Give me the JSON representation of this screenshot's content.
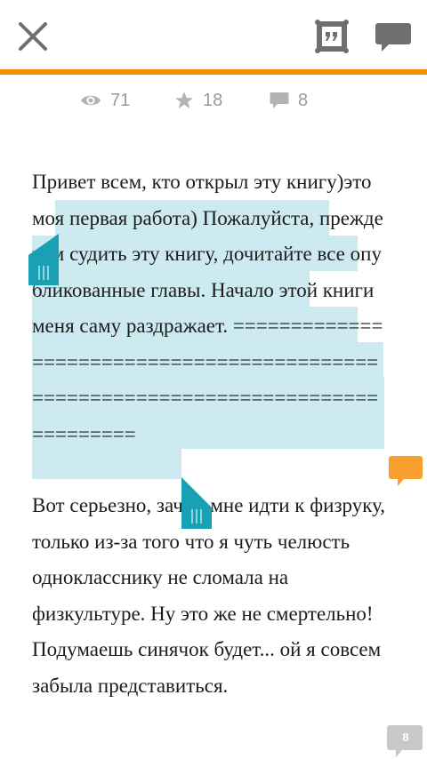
{
  "toolbar": {
    "close_icon": "close-icon",
    "quote_icon": "quote-frame-icon",
    "comments_icon": "comment-bubble-icon",
    "accent_color": "#f29200"
  },
  "stats": {
    "views": "71",
    "stars": "18",
    "comments": "8"
  },
  "selection": {
    "highlight_color": "#cdeaf0",
    "handle_color": "#1aa0b5"
  },
  "paragraphs": [
    {
      "text": "Привет всем, кто открыл эту книгу)это моя первая работа) Пожалуйста, прежде чем судить эту книгу, дочитайте все опубликованные главы. Начало этой книги меня саму раздражает. =================================================================================="
    },
    {
      "text": "Вот серьезно, зачем мне идти к физруку, только из-за того что я чуть челюсть однокласснику не сломала на физкультуре. Ну это же не смертельно! Подумаешь синячок будет... ой я совсем забыла представиться."
    }
  ],
  "inline_comments": {
    "paragraph1_color": "#f7a030",
    "paragraph2_count": "8",
    "paragraph2_color": "#c8c8c8"
  }
}
